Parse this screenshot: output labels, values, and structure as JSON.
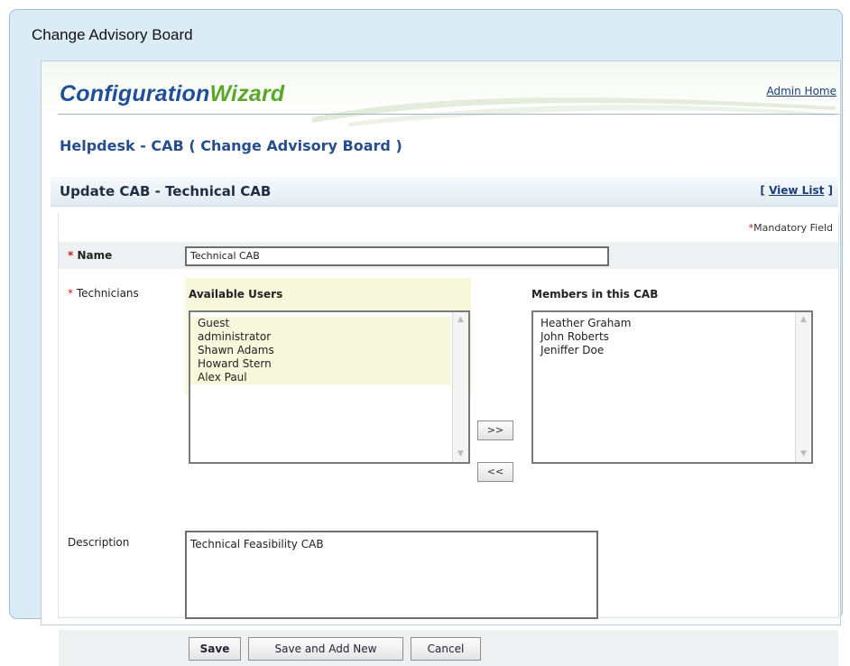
{
  "window": {
    "title": "Change Advisory Board"
  },
  "header": {
    "logo_part1": "Configuration",
    "logo_part2": "Wizard",
    "admin_home": "Admin Home"
  },
  "module": {
    "title": "Helpdesk - CAB ( Change Advisory Board )"
  },
  "section": {
    "title": "Update CAB - Technical CAB",
    "viewlist_open": "[",
    "viewlist_label": "View List",
    "viewlist_close": "]"
  },
  "form": {
    "mandatory_star": "*",
    "mandatory_label": "Mandatory Field",
    "required_star": "*",
    "name_label": "Name",
    "name_value": "Technical CAB",
    "technicians_label": "Technicians",
    "available_users_header": "Available Users",
    "available_users": [
      "Guest",
      "administrator",
      "Shawn Adams",
      "Howard Stern",
      "Alex Paul"
    ],
    "members_header": "Members in this CAB",
    "members": [
      "Heather Graham",
      "John Roberts",
      "Jeniffer Doe"
    ],
    "add_button": ">>",
    "remove_button": "<<",
    "description_label": "Description",
    "description_value": "Technical Feasibility CAB"
  },
  "buttons": {
    "save": "Save",
    "save_add_new": "Save and Add New",
    "cancel": "Cancel"
  },
  "colors": {
    "logo_blue": "#1f4f96",
    "logo_green": "#5aa72a",
    "link_blue": "#1c3f77",
    "required_red": "#c62020"
  }
}
